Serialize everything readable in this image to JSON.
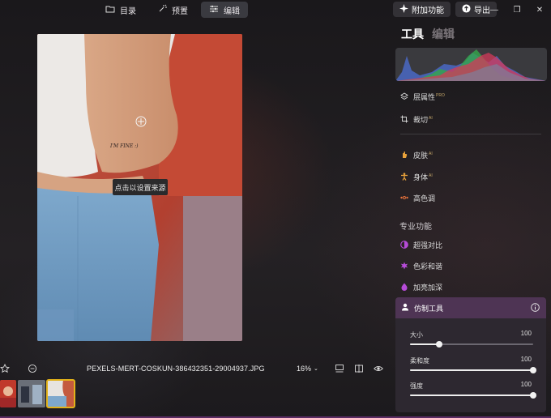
{
  "top_tabs": [
    {
      "label": "目录",
      "icon": "folder-icon",
      "active": false
    },
    {
      "label": "预置",
      "icon": "sparkle-icon",
      "active": false
    },
    {
      "label": "编辑",
      "icon": "sliders-icon",
      "active": true
    }
  ],
  "header_actions": {
    "addons_label": "附加功能",
    "export_label": "导出"
  },
  "canvas": {
    "tooltip": "点击以设置来源",
    "tattoo_text": "I'M FINE :)"
  },
  "bottom_bar": {
    "filename": "PEXELS-MERT-COSKUN-386432351-29004937.JPG",
    "zoom": "16%"
  },
  "panel": {
    "tabs": [
      {
        "label": "工具",
        "active": true
      },
      {
        "label": "编辑",
        "active": false
      }
    ],
    "tools": [
      {
        "label": "层属性",
        "badge": "PRO",
        "icon": "layers-icon"
      },
      {
        "label": "裁切",
        "badge": "AI",
        "icon": "crop-icon"
      },
      {
        "label": "皮肤",
        "badge": "AI",
        "icon": "hand-icon"
      },
      {
        "label": "身体",
        "badge": "AI",
        "icon": "body-icon"
      },
      {
        "label": "高色调",
        "badge": "",
        "icon": "dots-icon"
      }
    ],
    "pro_section_title": "专业功能",
    "pro_tools": [
      {
        "label": "超强对比",
        "icon": "contrast-icon"
      },
      {
        "label": "色彩和谐",
        "icon": "flower-icon"
      },
      {
        "label": "加亮加深",
        "icon": "drop-icon"
      }
    ],
    "clone_tool": {
      "title": "仿制工具",
      "sliders": [
        {
          "label": "大小",
          "value": "100",
          "fraction": 0.24
        },
        {
          "label": "柔和度",
          "value": "100",
          "fraction": 1.0
        },
        {
          "label": "强度",
          "value": "100",
          "fraction": 1.0
        }
      ]
    }
  },
  "colors": {
    "accent": "#4e3454",
    "highlight": "#e2b21a",
    "pro_icon": "#b64bd8"
  }
}
